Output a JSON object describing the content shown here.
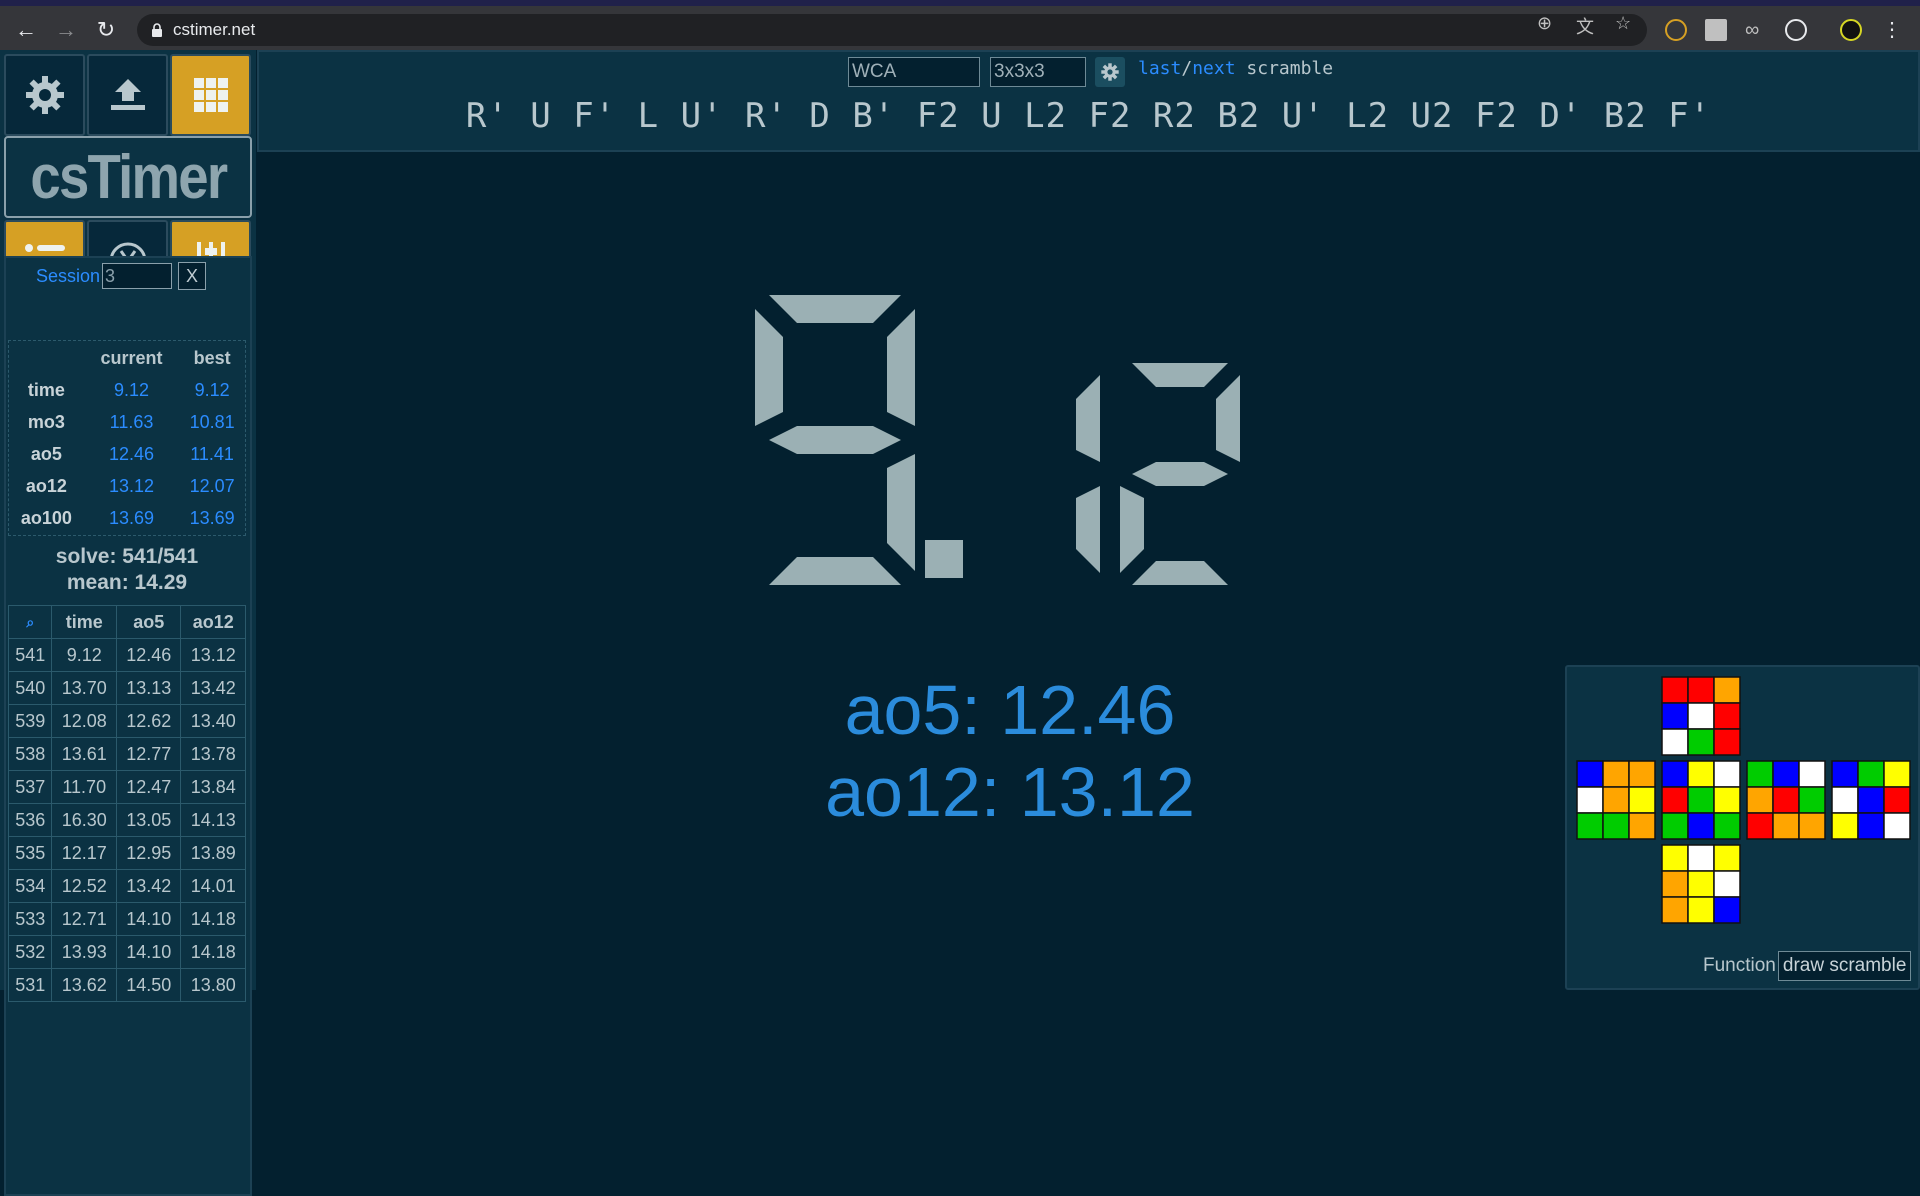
{
  "browser": {
    "url": "cstimer.net"
  },
  "sidebar": {
    "logo": "csTimer",
    "session_label": "Session",
    "session_value": "3",
    "session_close": "X",
    "stats_headers": [
      "",
      "current",
      "best"
    ],
    "stats": [
      {
        "label": "time",
        "current": "9.12",
        "best": "9.12"
      },
      {
        "label": "mo3",
        "current": "11.63",
        "best": "10.81"
      },
      {
        "label": "ao5",
        "current": "12.46",
        "best": "11.41"
      },
      {
        "label": "ao12",
        "current": "13.12",
        "best": "12.07"
      },
      {
        "label": "ao100",
        "current": "13.69",
        "best": "13.69"
      }
    ],
    "solve_line": "solve: 541/541",
    "mean_line": "mean: 14.29",
    "times_headers": [
      "⌕",
      "time",
      "ao5",
      "ao12"
    ],
    "times": [
      [
        "541",
        "9.12",
        "12.46",
        "13.12"
      ],
      [
        "540",
        "13.70",
        "13.13",
        "13.42"
      ],
      [
        "539",
        "12.08",
        "12.62",
        "13.40"
      ],
      [
        "538",
        "13.61",
        "12.77",
        "13.78"
      ],
      [
        "537",
        "11.70",
        "12.47",
        "13.84"
      ],
      [
        "536",
        "16.30",
        "13.05",
        "14.13"
      ],
      [
        "535",
        "12.17",
        "12.95",
        "13.89"
      ],
      [
        "534",
        "12.52",
        "13.42",
        "14.01"
      ],
      [
        "533",
        "12.71",
        "14.10",
        "14.18"
      ],
      [
        "532",
        "13.93",
        "14.10",
        "14.18"
      ],
      [
        "531",
        "13.62",
        "14.50",
        "13.80"
      ]
    ]
  },
  "toolbar": {
    "scramble_type": "WCA",
    "puzzle": "3x3x3",
    "last_label": "last",
    "slash": "/",
    "next_label": "next",
    "scramble_word": "scramble"
  },
  "scramble": "R' U F' L U' R' D B' F2 U L2 F2 R2 B2 U' L2 U2 F2 D' B2 F'",
  "timer": {
    "display": "9.12",
    "ao5_line": "ao5: 12.46",
    "ao12_line": "ao12: 13.12"
  },
  "colors": {
    "background": "#03202f",
    "panel": "#0b3243",
    "accent_yellow": "#d6a024",
    "blue_text": "#2b8cff",
    "digit": "#9bb0b4"
  },
  "cube_net": {
    "U": [
      "R",
      "R",
      "O",
      "B",
      "W",
      "R",
      "W",
      "G",
      "R"
    ],
    "L": [
      "B",
      "O",
      "O",
      "W",
      "O",
      "Y",
      "G",
      "G",
      "O"
    ],
    "F": [
      "B",
      "Y",
      "W",
      "R",
      "G",
      "Y",
      "G",
      "B",
      "G"
    ],
    "R": [
      "G",
      "B",
      "W",
      "O",
      "R",
      "G",
      "R",
      "O",
      "O"
    ],
    "B": [
      "B",
      "G",
      "Y",
      "W",
      "B",
      "R",
      "Y",
      "B",
      "W"
    ],
    "D": [
      "Y",
      "W",
      "Y",
      "O",
      "Y",
      "W",
      "O",
      "Y",
      "B"
    ]
  },
  "function_panel": {
    "label": "Function",
    "selected": "draw scramble"
  },
  "icons": [
    "back-icon",
    "forward-icon",
    "reload-icon",
    "lock-icon",
    "gear-icon",
    "upload-icon",
    "grid-icon",
    "list-icon",
    "yen-icon",
    "sliders-icon"
  ]
}
